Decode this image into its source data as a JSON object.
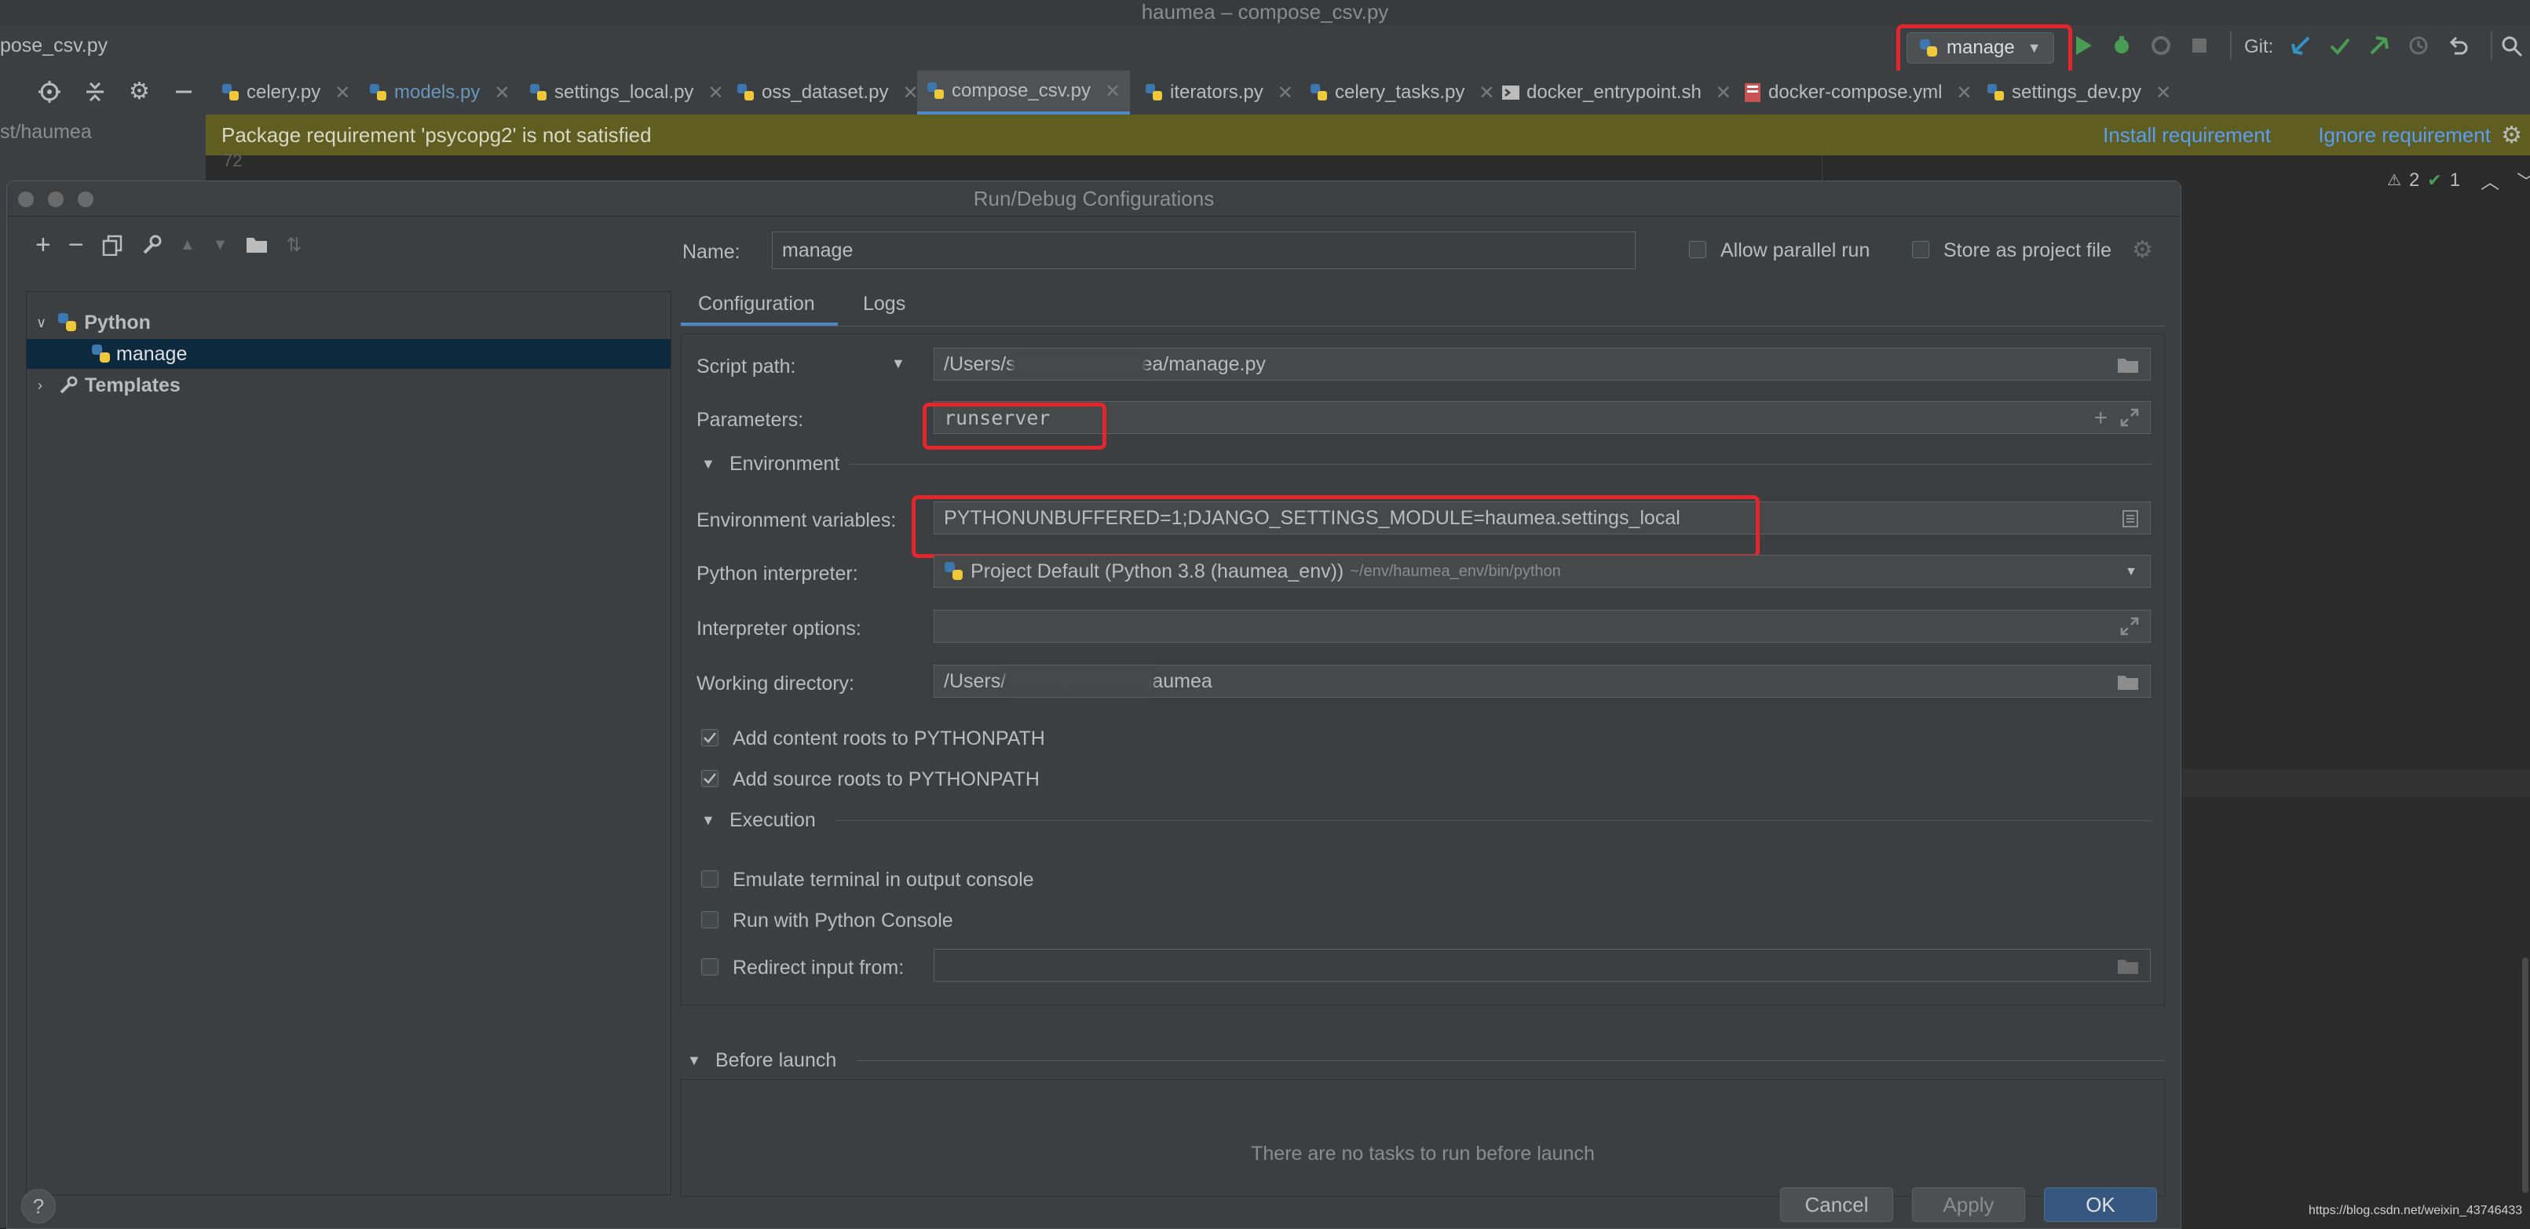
{
  "window": {
    "title": "haumea – compose_csv.py"
  },
  "navbar": {
    "file": "pose_csv.py",
    "run_config": "manage",
    "git_label": "Git:"
  },
  "tabs": [
    {
      "label": "celery.py",
      "color": "#bbbbbb",
      "active": false
    },
    {
      "label": "models.py",
      "color": "#6897bb",
      "active": false
    },
    {
      "label": "settings_local.py",
      "color": "#bbbbbb",
      "active": false
    },
    {
      "label": "oss_dataset.py",
      "color": "#bbbbbb",
      "active": false
    },
    {
      "label": "compose_csv.py",
      "color": "#bbbbbb",
      "active": true
    },
    {
      "label": "iterators.py",
      "color": "#bbbbbb",
      "active": false
    },
    {
      "label": "celery_tasks.py",
      "color": "#bbbbbb",
      "active": false
    },
    {
      "label": "docker_entrypoint.sh",
      "color": "#bbbbbb",
      "active": false
    },
    {
      "label": "docker-compose.yml",
      "color": "#bbbbbb",
      "active": false
    },
    {
      "label": "settings_dev.py",
      "color": "#bbbbbb",
      "active": false
    }
  ],
  "project_panel": {
    "path": "st/haumea"
  },
  "banner": {
    "message": "Package requirement 'psycopg2' is not satisfied",
    "install": "Install requirement",
    "ignore": "Ignore requirement"
  },
  "editor": {
    "line_number": "72",
    "warnings": "2",
    "checks": "1"
  },
  "dialog": {
    "title": "Run/Debug Configurations",
    "tree": {
      "python": "Python",
      "manage": "manage",
      "templates": "Templates"
    },
    "name_label": "Name:",
    "name_value": "manage",
    "allow_parallel": "Allow parallel run",
    "store_project": "Store as project file",
    "tabs": [
      "Configuration",
      "Logs"
    ],
    "script_path_label": "Script path:",
    "script_path_value": "/Users/s            t/haumea/manage.py",
    "parameters_label": "Parameters:",
    "parameters_value": "runserver",
    "environment_section": "Environment",
    "env_vars_label": "Environment variables:",
    "env_vars_value": "PYTHONUNBUFFERED=1;DJANGO_SETTINGS_MODULE=haumea.settings_local",
    "interpreter_label": "Python interpreter:",
    "interpreter_value": "Project Default (Python 3.8 (haumea_env))",
    "interpreter_path": "~/env/haumea_env/bin/python",
    "interp_options_label": "Interpreter options:",
    "working_dir_label": "Working directory:",
    "working_dir_value": "/Users/          ,stardust/haumea",
    "content_roots": "Add content roots to PYTHONPATH",
    "source_roots": "Add source roots to PYTHONPATH",
    "execution_section": "Execution",
    "emulate_terminal": "Emulate terminal in output console",
    "run_console": "Run with Python Console",
    "redirect_input": "Redirect input from:",
    "before_launch": "Before launch",
    "no_tasks": "There are no tasks to run before launch",
    "help": "?",
    "cancel": "Cancel",
    "apply": "Apply",
    "ok": "OK"
  },
  "watermark": "https://blog.csdn.net/weixin_43746433"
}
